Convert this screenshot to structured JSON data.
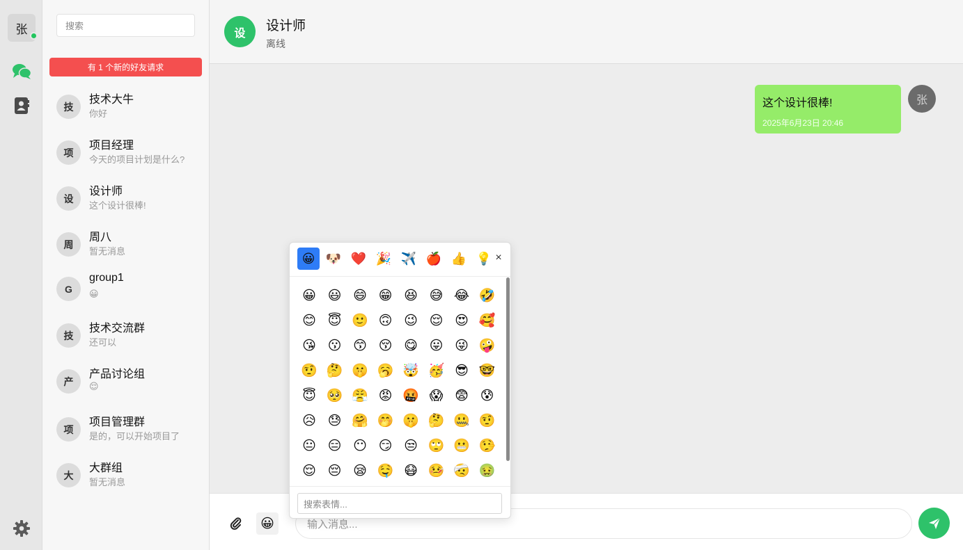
{
  "user": {
    "avatar_char": "张",
    "online": true
  },
  "rail": {
    "icons": [
      "chat-icon",
      "contacts-icon",
      "gear-icon"
    ],
    "accent": "#2ec26a"
  },
  "sidebar": {
    "search_placeholder": "搜索",
    "friend_request_text": "有 1 个新的好友请求",
    "conversations": [
      {
        "avatar": "技",
        "name": "技术大牛",
        "last": "你好"
      },
      {
        "avatar": "项",
        "name": "项目经理",
        "last": "今天的项目计划是什么?"
      },
      {
        "avatar": "设",
        "name": "设计师",
        "last": "这个设计很棒!"
      },
      {
        "avatar": "周",
        "name": "周八",
        "last": "暂无消息"
      },
      {
        "avatar": "G",
        "name": "group1",
        "last": "😀"
      },
      {
        "avatar": "技",
        "name": "技术交流群",
        "last": "还可以"
      },
      {
        "avatar": "产",
        "name": "产品讨论组",
        "last": "😌"
      },
      {
        "avatar": "项",
        "name": "项目管理群",
        "last": "是的，可以开始项目了"
      },
      {
        "avatar": "大",
        "name": "大群组",
        "last": "暂无消息"
      }
    ]
  },
  "chat": {
    "avatar": "设",
    "title": "设计师",
    "status": "离线",
    "messages": [
      {
        "text": "这个设计很棒!",
        "time": "2025年6月23日 20:46",
        "avatar": "张",
        "outgoing": true
      }
    ]
  },
  "input": {
    "placeholder": "输入消息...",
    "emoji_button": "😀"
  },
  "emoji_picker": {
    "tabs": [
      "😀",
      "🐶",
      "❤️",
      "🎉",
      "✈️",
      "🍎",
      "👍",
      "💡"
    ],
    "active_tab": 0,
    "close": "×",
    "emojis": [
      "😀",
      "😃",
      "😄",
      "😁",
      "😆",
      "😅",
      "😂",
      "🤣",
      "😊",
      "😇",
      "🙂",
      "🙃",
      "😉",
      "😌",
      "😍",
      "🥰",
      "😘",
      "😗",
      "😙",
      "😚",
      "😋",
      "😛",
      "😜",
      "🤪",
      "🤨",
      "🤔",
      "🤫",
      "🥱",
      "🤯",
      "🥳",
      "😎",
      "🤓",
      "😇",
      "🥺",
      "😤",
      "😡",
      "🤬",
      "😱",
      "😨",
      "😰",
      "😥",
      "😓",
      "🤗",
      "🤭",
      "🤫",
      "🤔",
      "🤐",
      "🤨",
      "😐",
      "😑",
      "😶",
      "😏",
      "😒",
      "🙄",
      "😬",
      "🤥",
      "😌",
      "😔",
      "😪",
      "🤤",
      "😷",
      "🤒",
      "🤕",
      "🤢"
    ],
    "search_placeholder": "搜索表情..."
  }
}
